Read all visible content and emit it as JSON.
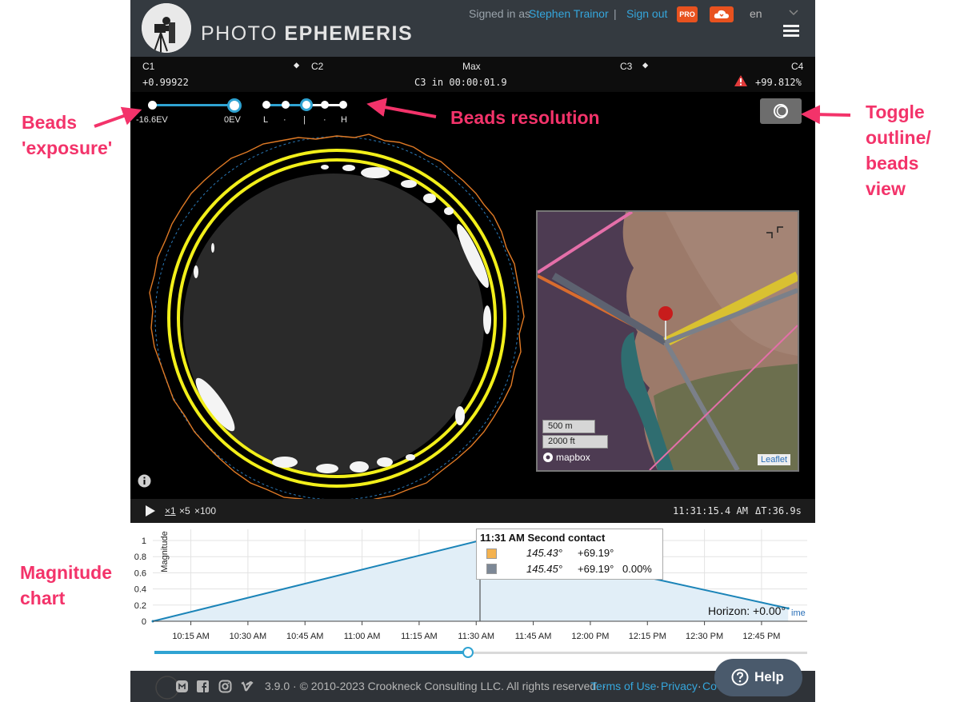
{
  "header": {
    "brand_light": "PHOTO",
    "brand_bold": "EPHEMERIS",
    "signed_in_prefix": "Signed in as",
    "user_name": "Stephen Trainor",
    "separator": "|",
    "sign_out": "Sign out",
    "pro_badge": "PRO",
    "language": "en",
    "accent_color": "#35a6dc",
    "badge_color": "#e8521f"
  },
  "contacts": {
    "c1": "C1",
    "c2": "C2",
    "max": "Max",
    "c3": "C3",
    "c4": "C4",
    "left_value": "+0.99922",
    "countdown": "C3 in 00:00:01.9",
    "right_value": "+99.812%"
  },
  "sliders": {
    "exposure_min": "-16.6EV",
    "exposure_max": "0EV",
    "resolution_labels": [
      "L",
      "·",
      "|",
      "·",
      "H"
    ]
  },
  "map": {
    "scale_metric": "500 m",
    "scale_imperial": "2000 ft",
    "provider": "mapbox",
    "attribution": "Leaflet"
  },
  "playback": {
    "speeds": [
      "×1",
      "×5",
      "×100"
    ],
    "time": "11:31:15.4 AM",
    "delta": "ΔT:36.9s"
  },
  "chart": {
    "tooltip_title": "11:31 AM Second contact",
    "tooltip_rows": [
      {
        "az": "145.43°",
        "alt": "+69.19°",
        "extra": ""
      },
      {
        "az": "145.45°",
        "alt": "+69.19°",
        "extra": "0.00%"
      }
    ],
    "horizon_label": "Horizon: +0.00°",
    "time_label": "ime"
  },
  "chart_data": {
    "type": "area",
    "ylabel": "Magnitude",
    "ylim": [
      0,
      1
    ],
    "yticks": [
      "0",
      "0.2",
      "0.4",
      "0.6",
      "0.8",
      "1"
    ],
    "xticks": [
      "10:15 AM",
      "10:30 AM",
      "10:45 AM",
      "11:00 AM",
      "11:15 AM",
      "11:30 AM",
      "11:45 AM",
      "12:00 PM",
      "12:15 PM",
      "12:30 PM",
      "12:45 PM"
    ],
    "x": [
      "10:05 AM",
      "11:31 AM",
      "12:52 PM"
    ],
    "series": [
      {
        "values": [
          0,
          1,
          0.16
        ]
      }
    ],
    "series_color": "#1b84b8",
    "fill_color": "#e1eef7"
  },
  "footer": {
    "version": "3.9.0 · © 2010-2023 Crookneck Consulting LLC. All rights reserved. ·",
    "terms": "Terms of Use",
    "dot": "·",
    "privacy": "Privacy",
    "cookies": "Co",
    "help": "Help"
  },
  "annotations": {
    "beads_exposure_1": "Beads",
    "beads_exposure_2": "'exposure'",
    "beads_resolution": "Beads resolution",
    "toggle_1": "Toggle",
    "toggle_2": "outline/",
    "toggle_3": "beads",
    "toggle_4": "view",
    "magnitude_1": "Magnitude",
    "magnitude_2": "chart",
    "color": "#f3336a"
  }
}
